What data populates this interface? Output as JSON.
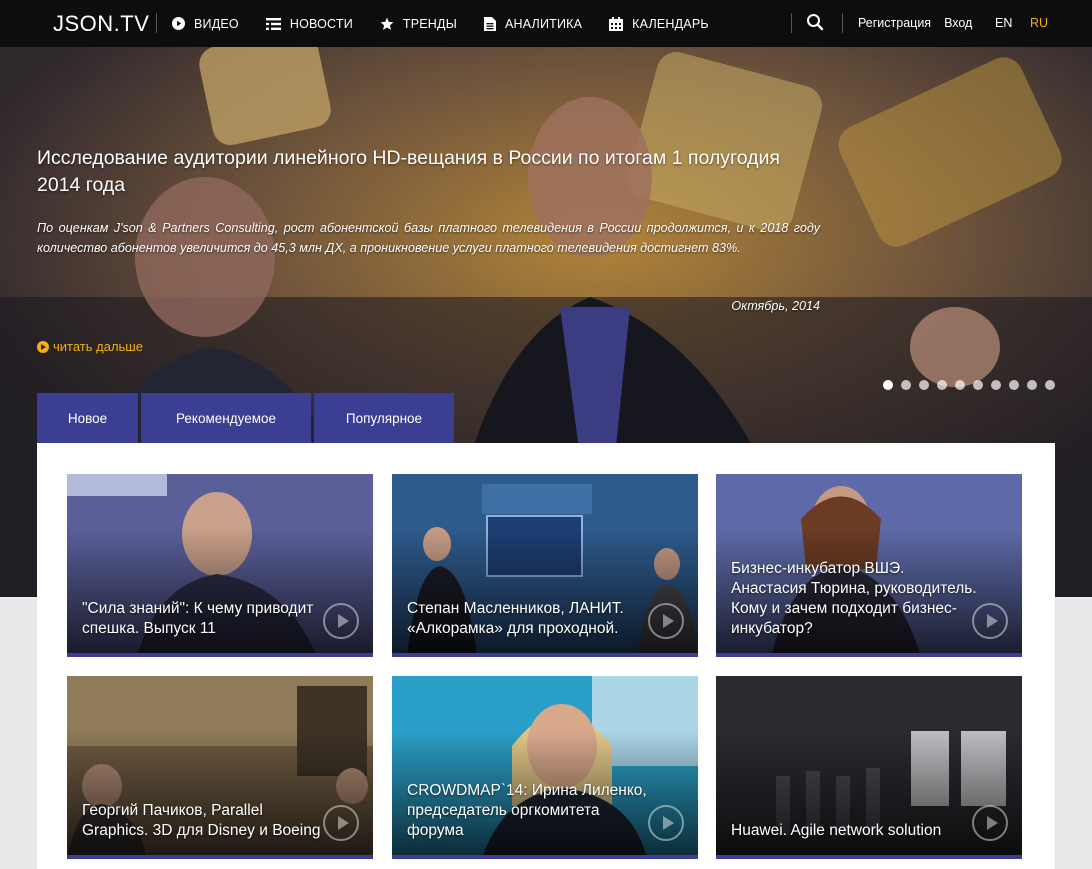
{
  "brand": {
    "logo": "JSON.TV",
    "accent": "#3b3e92",
    "highlight": "#f2b10c"
  },
  "nav": {
    "items": [
      {
        "label": "ВИДЕО",
        "icon": "play-circle-icon"
      },
      {
        "label": "НОВОСТИ",
        "icon": "news-list-icon"
      },
      {
        "label": "ТРЕНДЫ",
        "icon": "star-icon"
      },
      {
        "label": "АНАЛИТИКА",
        "icon": "document-icon"
      },
      {
        "label": "КАЛЕНДАРЬ",
        "icon": "calendar-icon"
      }
    ],
    "search_icon": "search-icon",
    "register": "Регистрация",
    "login": "Вход",
    "lang_en": "EN",
    "lang_ru": "RU"
  },
  "hero": {
    "title": "Исследование аудитории линейного HD-вещания в России по итогам 1 полугодия 2014 года",
    "lead": "По оценкам J'son & Partners Consulting, рост абонентской базы платного телевидения в России продолжится, и к 2018 году количество абонентов увеличится до 45,3 млн ДХ, а проникновение услуги платного телевидения достигнет 83%.",
    "date": "Октябрь, 2014",
    "read_more": "читать дальше",
    "slides": 10,
    "active_slide": 1
  },
  "tabs": [
    {
      "label": "Новое",
      "active": true
    },
    {
      "label": "Рекомендуемое",
      "active": false
    },
    {
      "label": "Популярное",
      "active": false
    }
  ],
  "videos": [
    {
      "caption": "\"Сила знаний\": К чему приводит спешка. Выпуск 11",
      "bg": "#5a5f9a"
    },
    {
      "caption": "Степан Масленников, ЛАНИТ. «Алкорамка» для проходной.",
      "bg": "#2e5a8c"
    },
    {
      "caption": "Бизнес-инкубатор ВШЭ. Анастасия Тюрина, руководитель. Кому и зачем подходит бизнес-инкубатор?",
      "bg": "#5e6aa8"
    },
    {
      "caption": "Георгий Пачиков, Parallel Graphics. 3D для Disney и Boeing",
      "bg": "#6e5a42"
    },
    {
      "caption": "CROWDMAP`14: Ирина Лиленко, председатель оргкомитета форума",
      "bg": "#2a9fc8"
    },
    {
      "caption": "Huawei. Agile network solution",
      "bg": "#2c2a30"
    }
  ]
}
